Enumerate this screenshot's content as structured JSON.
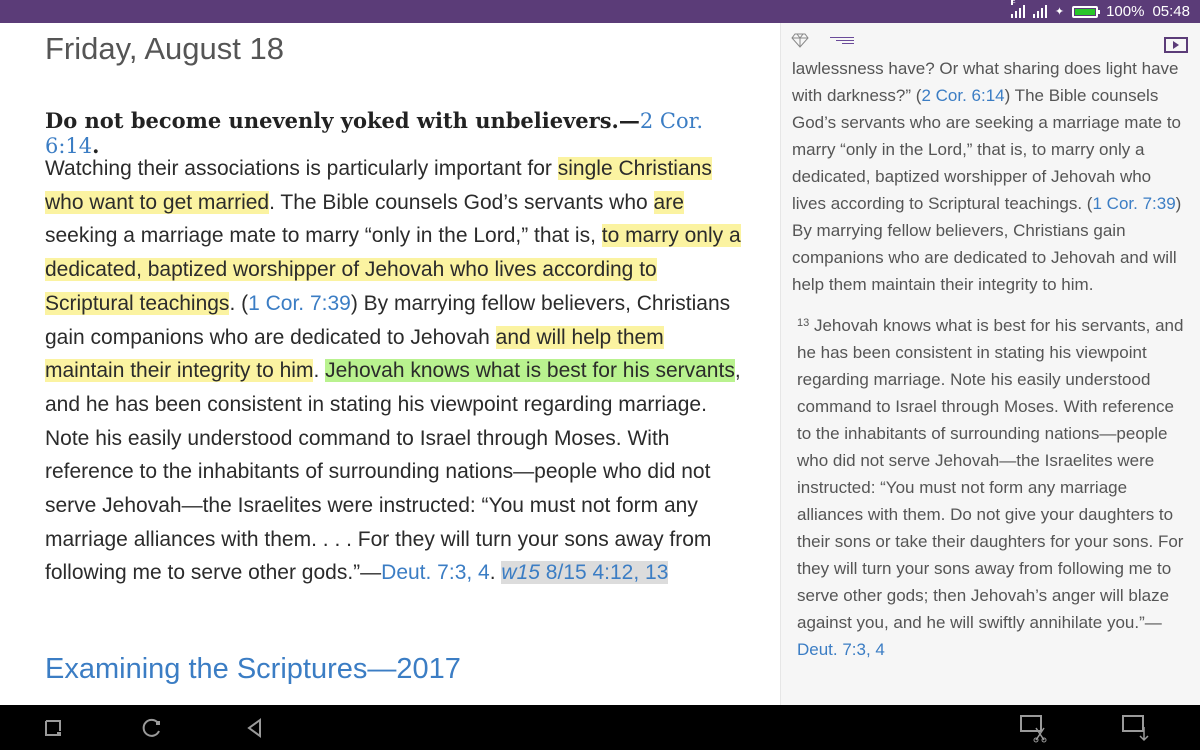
{
  "status": {
    "battery_percent": "100%",
    "time": "05:48",
    "signal_label": "E"
  },
  "article": {
    "date": "Friday, August 18",
    "theme_text": "Do not become unevenly yoked with unbelievers.—",
    "theme_ref": "2 Cor. 6:14",
    "theme_end": ".",
    "body": {
      "t1": "Watching their associations is particularly important for ",
      "h1": "single Christians who want to get married",
      "t2": ". The Bible counsels God’s servants who ",
      "h2": "are",
      "t3": " seeking a marriage mate to marry “only in the Lord,” that is, ",
      "h3": "to marry only a dedicated, baptized worshipper of Jehovah who lives according to Scriptural teachings",
      "t4": ". (",
      "ref1": "1 Cor. 7:39",
      "t5": ") By marrying fellow believers, Christians gain companions who are dedicated to Jehovah ",
      "h4": "and will help them maintain their integrity to him",
      "t6": ". ",
      "g1": "Jehovah knows what is best for his servants",
      "t7": ", and he has been consistent in stating his viewpoint regarding marriage. Note his easily understood command to Israel through Moses. With reference to the inhabitants of surrounding nations—people who did not serve Jehovah—the Israelites were instructed: “You must not form any marriage alliances with them. . . . For they will turn your sons away from following me to serve other gods.”—",
      "ref2": "Deut. 7:3, 4",
      "t8": ". ",
      "ref3_pub": "w15",
      "ref3_rest": " 8/15 4:12, 13"
    },
    "publication_title": "Examining the Scriptures—2017"
  },
  "side_panel": {
    "p1_a": "lawlessness have? Or what sharing does light have with darkness?” (",
    "p1_ref1": "2 Cor. 6:14",
    "p1_b": ") The Bible counsels God’s servants who are seeking a marriage mate to marry “only in the Lord,” that is, to marry only a dedicated, baptized worshipper of Jehovah who lives according to Scriptural teachings. (",
    "p1_ref2": "1 Cor. 7:39",
    "p1_c": ") By marrying fellow believers, Christians gain companions who are dedicated to Jehovah and will help them maintain their integrity to him.",
    "p2_num": "13",
    "p2_text": " Jehovah knows what is best for his servants, and he has been consistent in stating his viewpoint regarding marriage. Note his easily understood command to Israel through Moses. With reference to the inhabitants of surrounding nations—people who did not serve Jehovah—the Israelites were instructed: “You must not form any marriage alliances with them. Do not give your daughters to their sons or take their daughters for your sons. For they will turn your sons away from following me to serve other gods; then Jehovah’s anger will blaze against you, and he will swiftly annihilate you.”—",
    "p2_ref": "Deut. 7:3, 4"
  },
  "colors": {
    "status_bar": "#5b3c78",
    "link": "#3b7dc4",
    "highlight_yellow": "#fbf3a1",
    "highlight_green": "#b9f28f"
  },
  "icons": [
    "signal-icon",
    "bluetooth-icon",
    "battery-icon",
    "gem-icon",
    "lines-icon",
    "panel-toggle-icon",
    "square-nav-icon",
    "circle-nav-icon",
    "back-nav-icon",
    "screenshot-cut-icon",
    "screenshot-download-icon"
  ]
}
